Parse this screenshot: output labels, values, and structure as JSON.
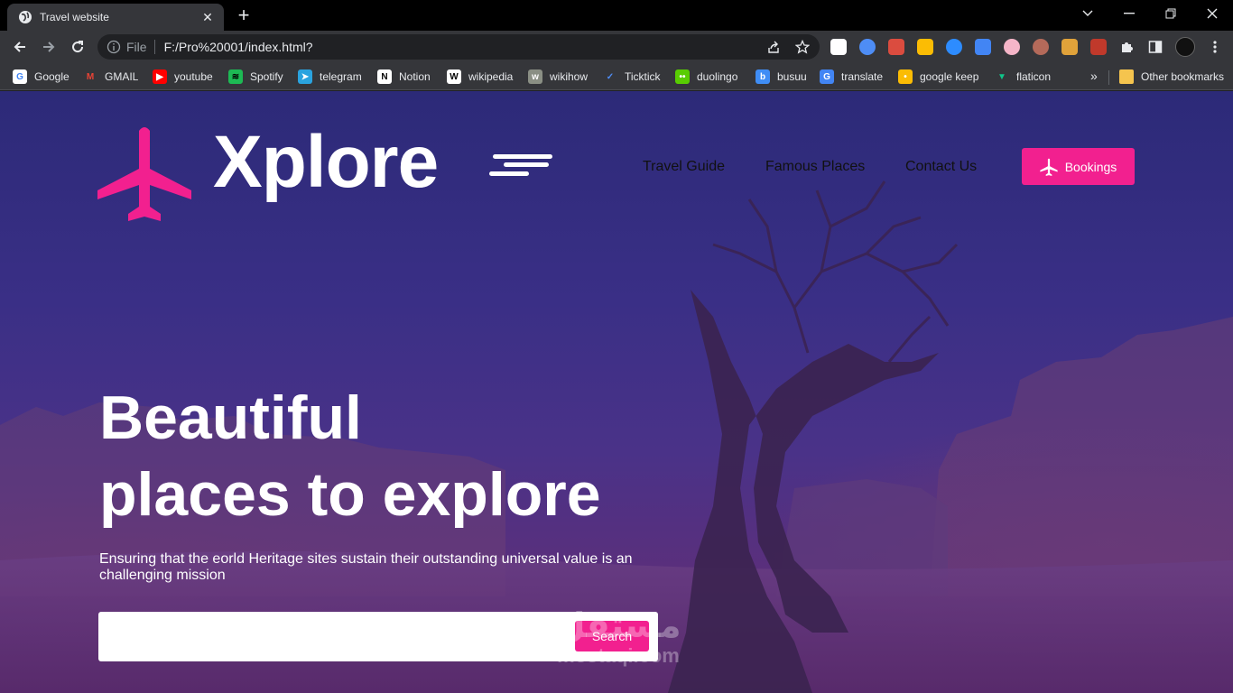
{
  "browser": {
    "tab_title": "Travel website",
    "url_scheme_label": "File",
    "url": "F:/Pro%20001/index.html?",
    "bookmarks": [
      {
        "label": "Google",
        "color": "#ffffff",
        "glyph": "G",
        "fg": "#4285f4"
      },
      {
        "label": "GMAIL",
        "color": "#35363a",
        "glyph": "M",
        "fg": "#ea4335"
      },
      {
        "label": "youtube",
        "color": "#ff0000",
        "glyph": "▶",
        "fg": "#ffffff"
      },
      {
        "label": "Spotify",
        "color": "#1db954",
        "glyph": "≋",
        "fg": "#000000"
      },
      {
        "label": "telegram",
        "color": "#2aa3df",
        "glyph": "➤",
        "fg": "#ffffff"
      },
      {
        "label": "Notion",
        "color": "#ffffff",
        "glyph": "N",
        "fg": "#000000"
      },
      {
        "label": "wikipedia",
        "color": "#ffffff",
        "glyph": "W",
        "fg": "#000000"
      },
      {
        "label": "wikihow",
        "color": "#8a8f84",
        "glyph": "w",
        "fg": "#ffffff"
      },
      {
        "label": "Ticktick",
        "color": "#35363a",
        "glyph": "✓",
        "fg": "#4e8df5"
      },
      {
        "label": "duolingo",
        "color": "#58cc02",
        "glyph": "••",
        "fg": "#ffffff"
      },
      {
        "label": "busuu",
        "color": "#3f8df5",
        "glyph": "b",
        "fg": "#ffffff"
      },
      {
        "label": "translate",
        "color": "#4285f4",
        "glyph": "G",
        "fg": "#ffffff"
      },
      {
        "label": "google keep",
        "color": "#fbbc04",
        "glyph": "•",
        "fg": "#ffffff"
      },
      {
        "label": "flaticon",
        "color": "#35363a",
        "glyph": "▼",
        "fg": "#10c58a"
      }
    ],
    "other_bookmarks": "Other bookmarks",
    "more_bookmarks": "»"
  },
  "site": {
    "logo_text": "Xplore",
    "nav": [
      "Travel Guide",
      "Famous Places",
      "Contact Us"
    ],
    "bookings_label": "Bookings",
    "hero_title_line1": "Beautiful",
    "hero_title_line2": "places to explore",
    "hero_subtitle": "Ensuring that the eorld Heritage sites sustain their outstanding universal value is an challenging mission",
    "search_value": "",
    "search_button": "Search",
    "accent_color": "#f2208f"
  },
  "watermark": {
    "arabic": "مستقل",
    "latin": "mostaqi.com"
  }
}
